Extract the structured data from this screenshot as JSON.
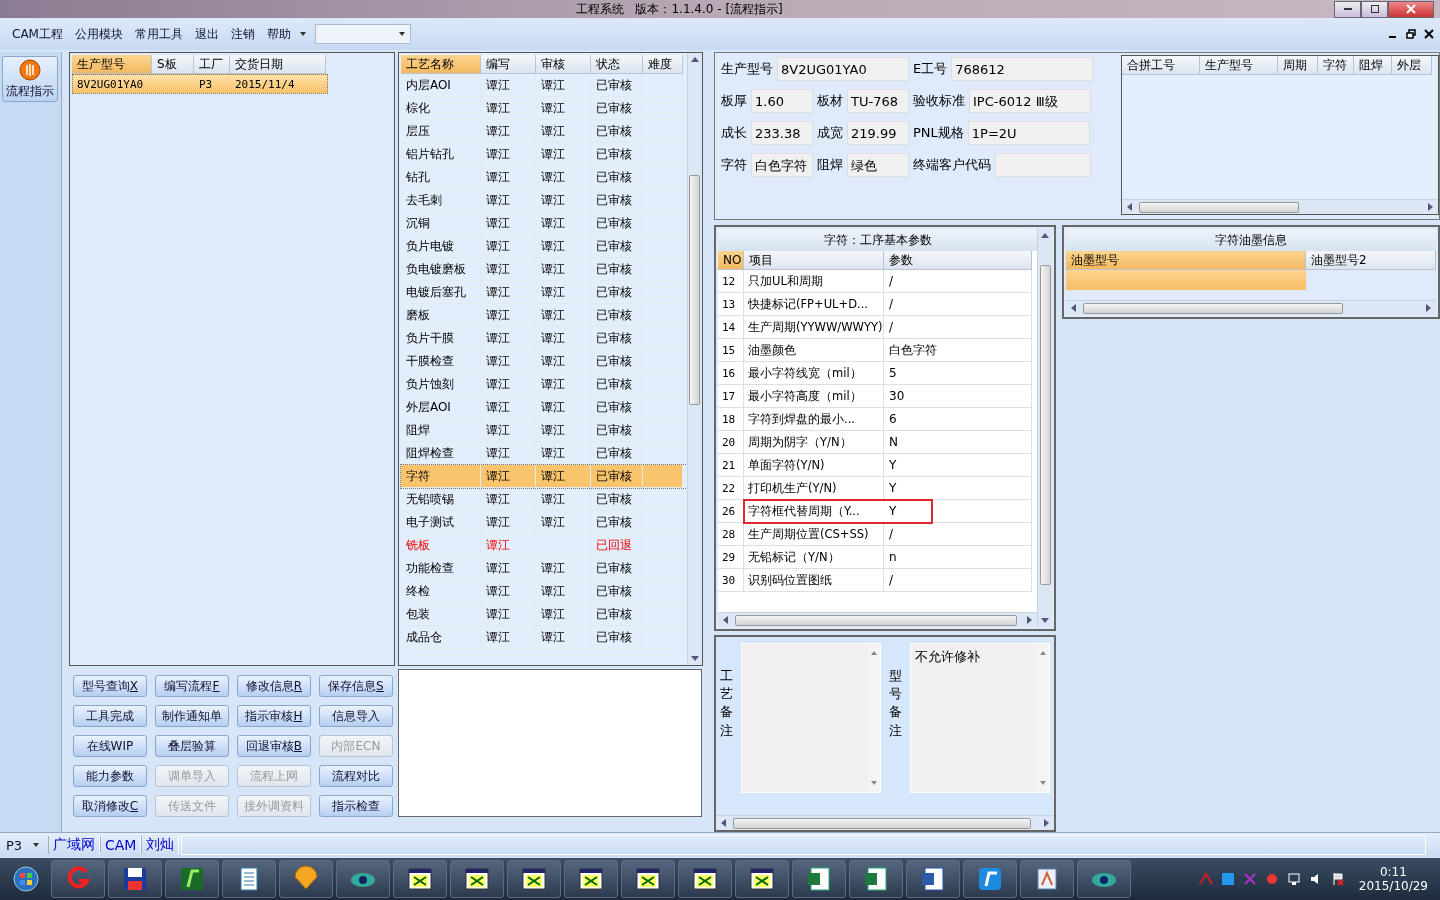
{
  "window": {
    "title": "工程系统   版本：1.1.4.0 - [流程指示]"
  },
  "menu": [
    "CAM工程",
    "公用模块",
    "常用工具",
    "退出",
    "注销",
    "帮助"
  ],
  "nav": {
    "label": "流程指示"
  },
  "order_list": {
    "columns": [
      "生产型号",
      "S板",
      "工厂",
      "交货日期"
    ],
    "rows": [
      {
        "cells": [
          "8V2UG01YA0",
          "",
          "P3",
          "2015/11/4"
        ],
        "selected": true
      }
    ]
  },
  "process_table": {
    "columns": [
      "工艺名称",
      "编写",
      "审核",
      "状态",
      "难度"
    ],
    "rows": [
      {
        "name": "内层AOI",
        "writer": "谭江",
        "reviewer": "谭江",
        "status": "已审核",
        "selected": false,
        "returned": false
      },
      {
        "name": "棕化",
        "writer": "谭江",
        "reviewer": "谭江",
        "status": "已审核",
        "selected": false,
        "returned": false
      },
      {
        "name": "层压",
        "writer": "谭江",
        "reviewer": "谭江",
        "status": "已审核",
        "selected": false,
        "returned": false
      },
      {
        "name": "铝片钻孔",
        "writer": "谭江",
        "reviewer": "谭江",
        "status": "已审核",
        "selected": false,
        "returned": false
      },
      {
        "name": "钻孔",
        "writer": "谭江",
        "reviewer": "谭江",
        "status": "已审核",
        "selected": false,
        "returned": false
      },
      {
        "name": "去毛刺",
        "writer": "谭江",
        "reviewer": "谭江",
        "status": "已审核",
        "selected": false,
        "returned": false
      },
      {
        "name": "沉铜",
        "writer": "谭江",
        "reviewer": "谭江",
        "status": "已审核",
        "selected": false,
        "returned": false
      },
      {
        "name": "负片电镀",
        "writer": "谭江",
        "reviewer": "谭江",
        "status": "已审核",
        "selected": false,
        "returned": false
      },
      {
        "name": "负电镀磨板",
        "writer": "谭江",
        "reviewer": "谭江",
        "status": "已审核",
        "selected": false,
        "returned": false
      },
      {
        "name": "电镀后塞孔",
        "writer": "谭江",
        "reviewer": "谭江",
        "status": "已审核",
        "selected": false,
        "returned": false
      },
      {
        "name": "磨板",
        "writer": "谭江",
        "reviewer": "谭江",
        "status": "已审核",
        "selected": false,
        "returned": false
      },
      {
        "name": "负片干膜",
        "writer": "谭江",
        "reviewer": "谭江",
        "status": "已审核",
        "selected": false,
        "returned": false
      },
      {
        "name": "干膜检查",
        "writer": "谭江",
        "reviewer": "谭江",
        "status": "已审核",
        "selected": false,
        "returned": false
      },
      {
        "name": "负片蚀刻",
        "writer": "谭江",
        "reviewer": "谭江",
        "status": "已审核",
        "selected": false,
        "returned": false
      },
      {
        "name": "外层AOI",
        "writer": "谭江",
        "reviewer": "谭江",
        "status": "已审核",
        "selected": false,
        "returned": false
      },
      {
        "name": "阻焊",
        "writer": "谭江",
        "reviewer": "谭江",
        "status": "已审核",
        "selected": false,
        "returned": false
      },
      {
        "name": "阻焊检查",
        "writer": "谭江",
        "reviewer": "谭江",
        "status": "已审核",
        "selected": false,
        "returned": false
      },
      {
        "name": "字符",
        "writer": "谭江",
        "reviewer": "谭江",
        "status": "已审核",
        "selected": true,
        "returned": false
      },
      {
        "name": "无铅喷锡",
        "writer": "谭江",
        "reviewer": "谭江",
        "status": "已审核",
        "selected": false,
        "returned": false
      },
      {
        "name": "电子测试",
        "writer": "谭江",
        "reviewer": "谭江",
        "status": "已审核",
        "selected": false,
        "returned": false
      },
      {
        "name": "铣板",
        "writer": "谭江",
        "status": "已回退",
        "selected": false,
        "returned": true
      },
      {
        "name": "功能检查",
        "writer": "谭江",
        "reviewer": "谭江",
        "status": "已审核",
        "selected": false,
        "returned": false
      },
      {
        "name": "终检",
        "writer": "谭江",
        "reviewer": "谭江",
        "status": "已审核",
        "selected": false,
        "returned": false
      },
      {
        "name": "包装",
        "writer": "谭江",
        "reviewer": "谭江",
        "status": "已审核",
        "selected": false,
        "returned": false
      },
      {
        "name": "成品仓",
        "writer": "谭江",
        "reviewer": "谭江",
        "status": "已审核",
        "selected": false,
        "returned": false
      }
    ]
  },
  "buttons": [
    {
      "label": "型号查询",
      "shortcut": "X",
      "disabled": false
    },
    {
      "label": "编写流程",
      "shortcut": "F",
      "disabled": false
    },
    {
      "label": "修改信息",
      "shortcut": "R",
      "disabled": false
    },
    {
      "label": "保存信息",
      "shortcut": "S",
      "disabled": false
    },
    {
      "label": "工具完成",
      "disabled": false
    },
    {
      "label": "制作通知单",
      "disabled": false
    },
    {
      "label": "指示审核",
      "shortcut": "H",
      "disabled": false
    },
    {
      "label": "信息导入",
      "disabled": false
    },
    {
      "label": "在线WIP",
      "disabled": false
    },
    {
      "label": "叠层验算",
      "disabled": false
    },
    {
      "label": "回退审核",
      "shortcut": "B",
      "disabled": false
    },
    {
      "label": "内部ECN",
      "disabled": true
    },
    {
      "label": "能力参数",
      "disabled": false
    },
    {
      "label": "调单导入",
      "disabled": true
    },
    {
      "label": "流程上网",
      "disabled": true
    },
    {
      "label": "流程对比",
      "disabled": false
    },
    {
      "label": "取消修改",
      "shortcut": "C",
      "disabled": false
    },
    {
      "label": "传送文件",
      "disabled": true
    },
    {
      "label": "接外调资料",
      "disabled": true
    },
    {
      "label": "指示检查",
      "disabled": false
    }
  ],
  "info": [
    [
      {
        "label": "生产型号",
        "value": "8V2UG01YA0"
      },
      {
        "label": "E工号",
        "value": "768612"
      }
    ],
    [
      {
        "label": "板厚",
        "value": "1.60"
      },
      {
        "label": "板材",
        "value": "TU-768"
      },
      {
        "label": "验收标准",
        "value": "IPC-6012 Ⅲ级"
      }
    ],
    [
      {
        "label": "成长",
        "value": "233.38"
      },
      {
        "label": "成宽",
        "value": "219.99"
      },
      {
        "label": "PNL规格",
        "value": "1P=2U"
      }
    ],
    [
      {
        "label": "字符",
        "value": "白色字符"
      },
      {
        "label": "阻焊",
        "value": "绿色"
      },
      {
        "label": "终端客户代码"
      }
    ]
  ],
  "combo_table": {
    "columns": [
      "合拼工号",
      "生产型号",
      "周期",
      "字符",
      "阻焊",
      "外层"
    ]
  },
  "params_table": {
    "title": "字符：工序基本参数",
    "columns": [
      "NO",
      "项目",
      "参数"
    ],
    "rows": [
      {
        "no": "12",
        "item": "只加UL和周期",
        "value": "/",
        "flagged": false
      },
      {
        "no": "13",
        "item": "快捷标记(FP+UL+D...",
        "value": "/",
        "flagged": false
      },
      {
        "no": "14",
        "item": "生产周期(YYWW/WWYY)",
        "value": "/",
        "flagged": false
      },
      {
        "no": "15",
        "item": "油墨颜色",
        "value": "白色字符",
        "flagged": false
      },
      {
        "no": "16",
        "item": "最小字符线宽（mil）",
        "value": "5",
        "flagged": false
      },
      {
        "no": "17",
        "item": "最小字符高度（mil）",
        "value": "30",
        "flagged": false
      },
      {
        "no": "18",
        "item": "字符到焊盘的最小...",
        "value": "6",
        "flagged": false
      },
      {
        "no": "20",
        "item": "周期为阴字（Y/N）",
        "value": "N",
        "flagged": false
      },
      {
        "no": "21",
        "item": "单面字符(Y/N)",
        "value": "Y",
        "flagged": false
      },
      {
        "no": "22",
        "item": "打印机生产(Y/N)",
        "value": "Y",
        "flagged": false
      },
      {
        "no": "26",
        "item": "字符框代替周期（Y...",
        "value": "Y",
        "flagged": true
      },
      {
        "no": "28",
        "item": "生产周期位置(CS+SS)",
        "value": "/",
        "flagged": false
      },
      {
        "no": "29",
        "item": "无铅标记（Y/N）",
        "value": "n",
        "flagged": false
      },
      {
        "no": "30",
        "item": "识别码位置图纸",
        "value": "/",
        "flagged": false
      }
    ]
  },
  "ink_table": {
    "title": "字符油墨信息",
    "columns": [
      "油墨型号",
      "油墨型号2"
    ],
    "rows": [
      {
        "selected": true
      }
    ]
  },
  "notes": [
    {
      "label": "工艺备注"
    },
    {
      "label": "型号备注",
      "value": "不允许修补"
    }
  ],
  "status_bar": {
    "plant": "P3",
    "items": [
      "广域网",
      "CAM",
      "刘灿"
    ]
  },
  "taskbar": {
    "time": "0:11",
    "date": "2015/10/29"
  }
}
